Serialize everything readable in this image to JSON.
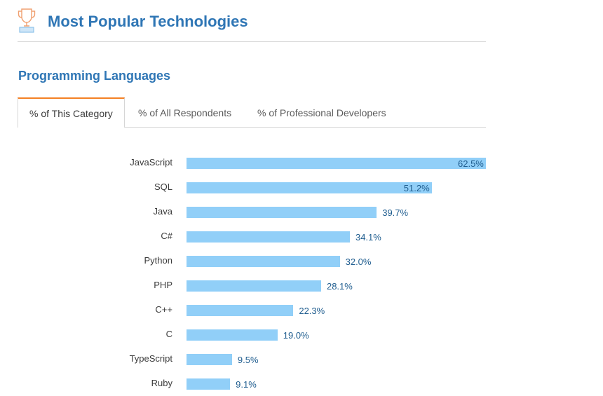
{
  "header": {
    "title": "Most Popular Technologies",
    "icon": "trophy-icon"
  },
  "section": {
    "title": "Programming Languages"
  },
  "tabs": [
    {
      "label": "% of This Category",
      "active": true
    },
    {
      "label": "% of All Respondents",
      "active": false
    },
    {
      "label": "% of Professional Developers",
      "active": false
    }
  ],
  "colors": {
    "accent": "#2f76b5",
    "tab_active_border": "#f48024",
    "bar": "#91cff8",
    "value_text": "#1f5d8f"
  },
  "chart_data": {
    "type": "bar",
    "orientation": "horizontal",
    "title": "Programming Languages",
    "xlabel": "",
    "ylabel": "",
    "unit": "%",
    "categories": [
      "JavaScript",
      "SQL",
      "Java",
      "C#",
      "Python",
      "PHP",
      "C++",
      "C",
      "TypeScript",
      "Ruby"
    ],
    "values": [
      62.5,
      51.2,
      39.7,
      34.1,
      32.0,
      28.1,
      22.3,
      19.0,
      9.5,
      9.1
    ],
    "value_labels": [
      "62.5%",
      "51.2%",
      "39.7%",
      "34.1%",
      "32.0%",
      "28.1%",
      "22.3%",
      "19.0%",
      "9.5%",
      "9.1%"
    ],
    "xlim": [
      0,
      62.5
    ],
    "grid": false,
    "legend": "none"
  }
}
